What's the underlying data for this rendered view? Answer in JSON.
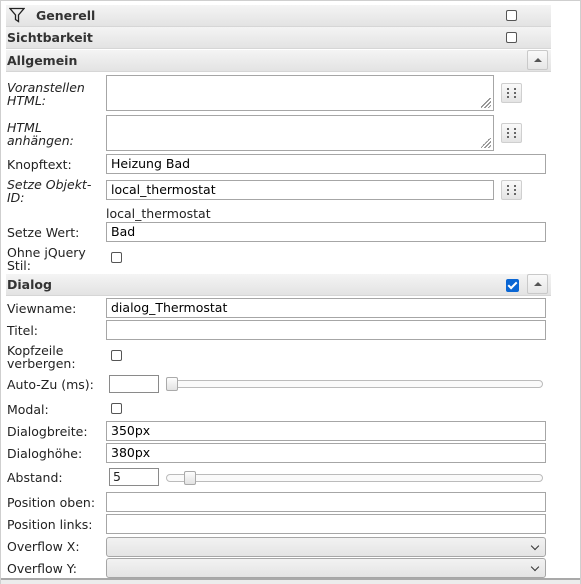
{
  "sections": {
    "generell": {
      "title": "Generell",
      "checked": false
    },
    "sichtbarkeit": {
      "title": "Sichtbarkeit",
      "checked": false
    },
    "allgemein": {
      "title": "Allgemein"
    },
    "dialog": {
      "title": "Dialog",
      "checked": true
    }
  },
  "allgemein": {
    "prepend_html": {
      "label": "Voranstellen HTML:",
      "value": ""
    },
    "append_html": {
      "label": "HTML anhängen:",
      "value": ""
    },
    "button_text": {
      "label": "Knopftext:",
      "value": "Heizung Bad"
    },
    "object_id": {
      "label": "Setze Objekt-ID:",
      "value": "local_thermostat",
      "resolved": "local_thermostat"
    },
    "set_value": {
      "label": "Setze Wert:",
      "value": "Bad"
    },
    "no_jquery": {
      "label": "Ohne jQuery Stil:",
      "checked": false
    }
  },
  "dialog": {
    "viewname": {
      "label": "Viewname:",
      "value": "dialog_Thermostat"
    },
    "title": {
      "label": "Titel:",
      "value": ""
    },
    "hide_header": {
      "label": "Kopfzeile verbergen:",
      "checked": false
    },
    "auto_close": {
      "label": "Auto-Zu (ms):",
      "value": "",
      "slider_fraction": 0.0
    },
    "modal": {
      "label": "Modal:",
      "checked": false
    },
    "dialog_width": {
      "label": "Dialogbreite:",
      "value": "350px"
    },
    "dialog_height": {
      "label": "Dialoghöhe:",
      "value": "380px"
    },
    "padding": {
      "label": "Abstand:",
      "value": "5",
      "slider_fraction": 0.05
    },
    "position_top": {
      "label": "Position oben:",
      "value": ""
    },
    "position_left": {
      "label": "Position links:",
      "value": ""
    },
    "overflow_x": {
      "label": "Overflow X:",
      "value": ""
    },
    "overflow_y": {
      "label": "Overflow Y:",
      "value": ""
    }
  },
  "colors": {
    "accent": "#0a66d4",
    "section_bg": "#e8e8e8"
  }
}
